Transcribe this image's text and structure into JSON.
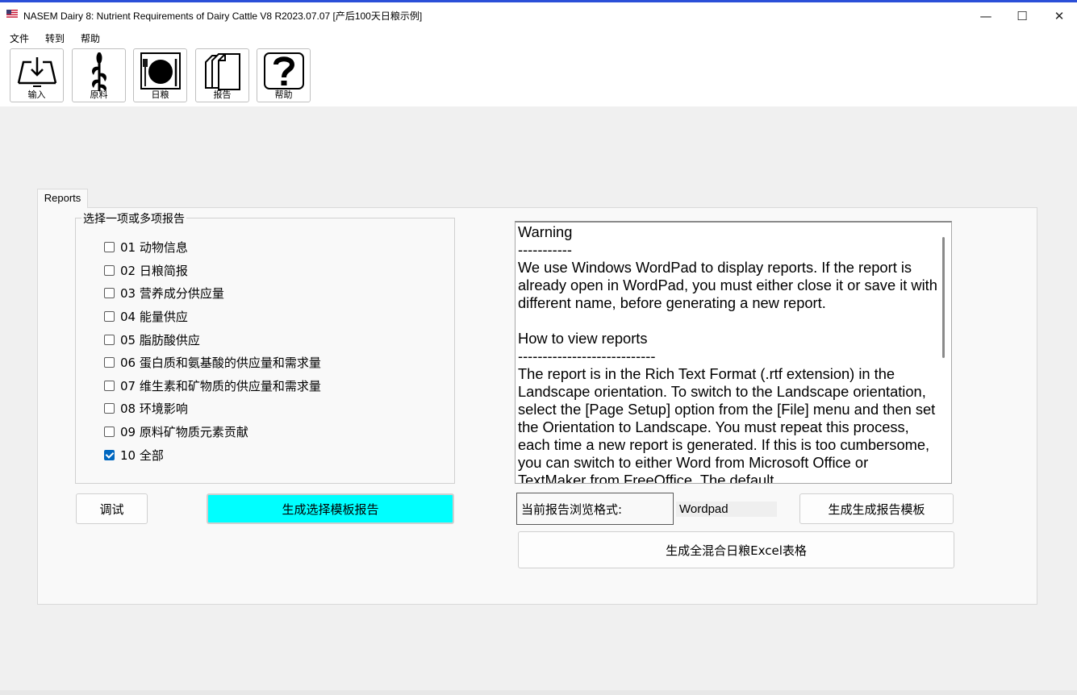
{
  "window": {
    "title": "NASEM Dairy 8: Nutrient Requirements of Dairy Cattle  V8 R2023.07.07 [产后100天日粮示例]",
    "minimize": "—",
    "maximize": "☐",
    "close": "✕"
  },
  "menu": [
    "文件",
    "转到",
    "帮助"
  ],
  "toolbar": [
    {
      "label": "输入",
      "icon": "input-icon"
    },
    {
      "label": "原料",
      "icon": "corn-feed-icon"
    },
    {
      "label": "日粮",
      "icon": "plate-utensils-icon"
    },
    {
      "label": "报告",
      "icon": "reports-icon"
    },
    {
      "label": "帮助",
      "icon": "help-question-icon"
    }
  ],
  "tab": {
    "label": "Reports"
  },
  "report_group": {
    "title": "选择一项或多项报告",
    "items": [
      {
        "label": "01 动物信息",
        "checked": false
      },
      {
        "label": "02 日粮简报",
        "checked": false
      },
      {
        "label": "03 营养成分供应量",
        "checked": false
      },
      {
        "label": "04 能量供应",
        "checked": false
      },
      {
        "label": "05 脂肪酸供应",
        "checked": false
      },
      {
        "label": "06 蛋白质和氨基酸的供应量和需求量",
        "checked": false
      },
      {
        "label": "07 维生素和矿物质的供应量和需求量",
        "checked": false
      },
      {
        "label": "08 环境影响",
        "checked": false
      },
      {
        "label": "09 原料矿物质元素贡献",
        "checked": false
      },
      {
        "label": "10 全部",
        "checked": true
      }
    ]
  },
  "buttons": {
    "debug": "调试",
    "generate_selected": "生成选择模板报告",
    "generate_template": "生成生成报告模板",
    "generate_excel": "生成全混合日粮Excel表格"
  },
  "viewer": {
    "label": "当前报告浏览格式:",
    "value": "Wordpad"
  },
  "info_text": [
    "Warning",
    "-----------",
    "We use Windows WordPad to display reports. If the report is already open in WordPad, you must either close it or save it with different name, before generating a new report.",
    "",
    "How to view reports",
    "----------------------------",
    "The report is in the Rich Text Format (.rtf extension) in the Landscape orientation. To switch to the Landscape orientation, select the [Page Setup] option from the [File] menu and then set the Orientation to Landscape. You must repeat this process, each time a new report is generated. If this is too cumbersome, you can switch to either Word from Microsoft Office or TextMaker from FreeOffice. The default"
  ],
  "colors": {
    "accent_button": "#00ffff",
    "checkbox_checked": "#0067c0",
    "title_border": "#2b4fd8"
  }
}
